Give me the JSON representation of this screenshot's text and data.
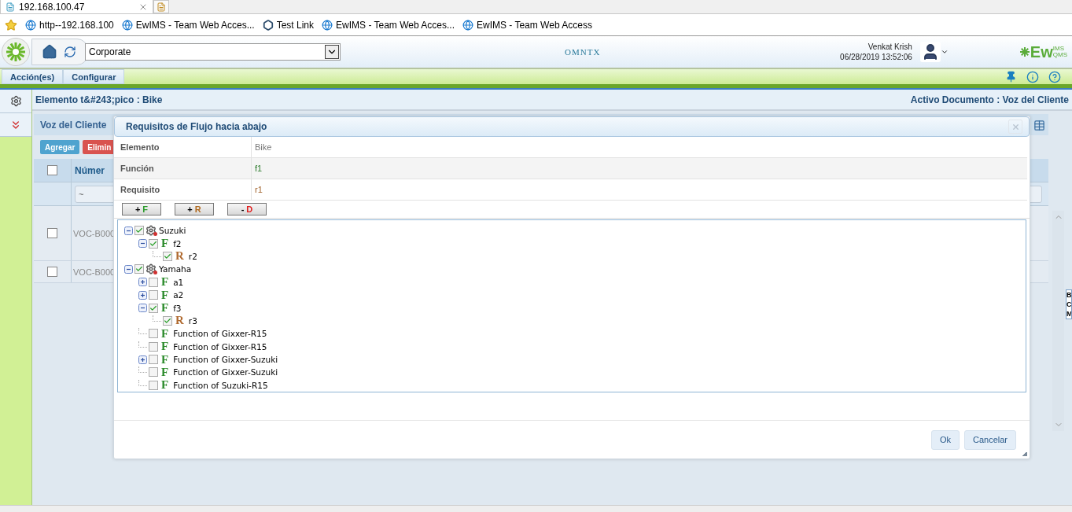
{
  "browser": {
    "tab": {
      "title": "192.168.100.47"
    },
    "favorites": [
      {
        "label": "http--192.168.100",
        "kind": "page"
      },
      {
        "label": "EwIMS - Team Web Acces...",
        "kind": "page"
      },
      {
        "label": "Test Link",
        "kind": "hex"
      },
      {
        "label": "EwIMS - Team Web Acces...",
        "kind": "page"
      },
      {
        "label": "EwIMS - Team Web Access",
        "kind": "page"
      }
    ]
  },
  "header": {
    "company_select": {
      "value": "Corporate"
    },
    "center_logo": "OMNTX",
    "user": {
      "name": "Venkat Krish",
      "datetime": "06/28/2019 13:52:06"
    },
    "brand_logo": {
      "main": "Ew",
      "top": "IMS",
      "bottom": "QMS"
    }
  },
  "menu": {
    "tabs": [
      "Acción(es)",
      "Configurar"
    ]
  },
  "breadcrumb": {
    "left": "Elemento t&#243;pico : Bike",
    "right": "Activo Documento : Voz del Cliente"
  },
  "panel": {
    "title": "Voz del Cliente",
    "buttons": [
      {
        "label": "Agregar",
        "kind": "add"
      },
      {
        "label": "Elimin",
        "kind": "delete"
      }
    ],
    "grid": {
      "select_all": {
        "checked": false
      },
      "column": "Númer",
      "filter": "~",
      "rows": [
        {
          "id": "VOC-B000",
          "checked": false
        },
        {
          "id": "VOC-B000",
          "checked": false
        }
      ]
    }
  },
  "side_popup": {
    "lines": [
      "B",
      "C",
      "M"
    ]
  },
  "dialog": {
    "title": "Requisitos de Flujo hacia abajo",
    "fields": [
      {
        "label": "Elemento",
        "value": "Bike",
        "kind": "plain"
      },
      {
        "label": "Función",
        "value": "f1",
        "kind": "function"
      },
      {
        "label": "Requisito",
        "value": "r1",
        "kind": "requirement"
      }
    ],
    "tools": [
      {
        "sign": "+",
        "letter": "F",
        "kind": "function"
      },
      {
        "sign": "+",
        "letter": "R",
        "kind": "requirement"
      },
      {
        "sign": "-",
        "letter": "D",
        "kind": "delete"
      }
    ],
    "tree": [
      {
        "label": "Suzuki",
        "kind": "group",
        "checked": true,
        "expanded": true,
        "children": [
          {
            "label": "f2",
            "kind": "function",
            "glyph": "F",
            "checked": true,
            "expanded": true,
            "children": [
              {
                "label": "r2",
                "kind": "requirement",
                "glyph": "R",
                "checked": true
              }
            ]
          }
        ]
      },
      {
        "label": "Yamaha",
        "kind": "group",
        "checked": true,
        "expanded": true,
        "children": [
          {
            "label": "a1",
            "kind": "function",
            "glyph": "F",
            "checked": false,
            "expanded": false
          },
          {
            "label": "a2",
            "kind": "function",
            "glyph": "F",
            "checked": false,
            "expanded": false
          },
          {
            "label": "f3",
            "kind": "function",
            "glyph": "F",
            "checked": true,
            "expanded": true,
            "children": [
              {
                "label": "r3",
                "kind": "requirement",
                "glyph": "R",
                "checked": true
              }
            ]
          },
          {
            "label": "Function of Gixxer-R15",
            "kind": "function",
            "glyph": "F",
            "checked": false
          },
          {
            "label": "Function of Gixxer-R15",
            "kind": "function",
            "glyph": "F",
            "checked": false
          },
          {
            "label": "Function of Gixxer-Suzuki",
            "kind": "function",
            "glyph": "F",
            "checked": false,
            "expanded": false
          },
          {
            "label": "Function of Gixxer-Suzuki",
            "kind": "function",
            "glyph": "F",
            "checked": false
          },
          {
            "label": "Function of Suzuki-R15",
            "kind": "function",
            "glyph": "F",
            "checked": false
          }
        ]
      }
    ],
    "buttons": [
      "Ok",
      "Cancelar"
    ]
  }
}
